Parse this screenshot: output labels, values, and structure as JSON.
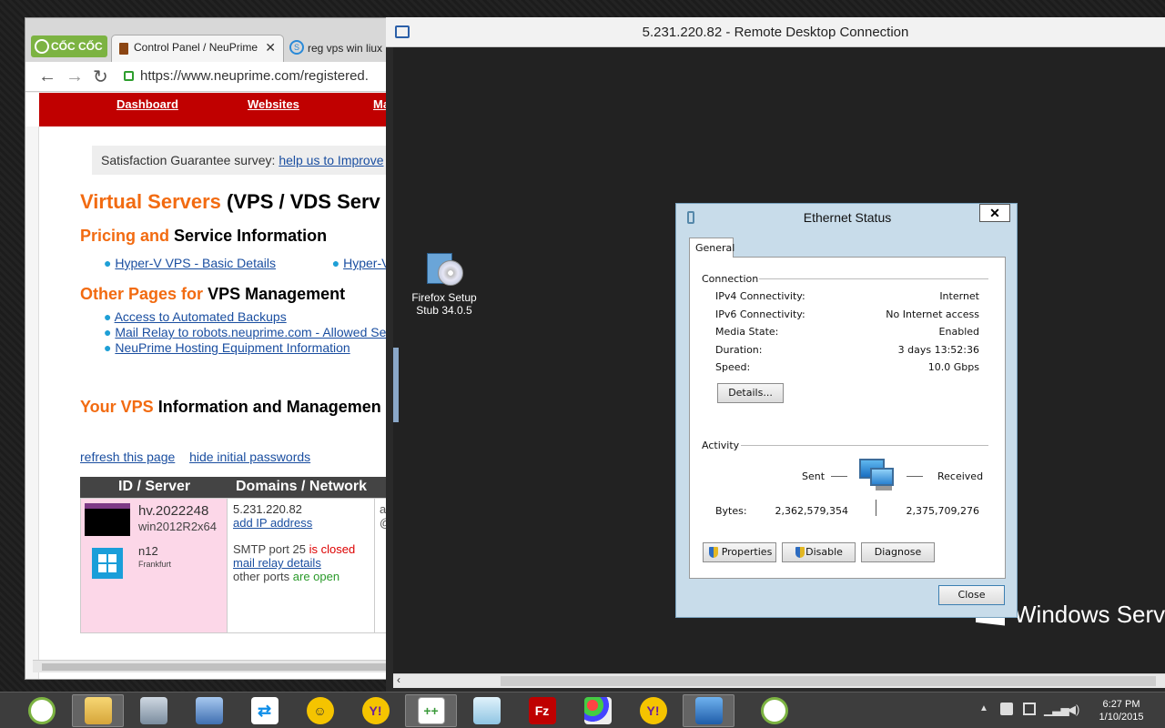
{
  "browser": {
    "logo_text": "CỐC CỐC",
    "tabs": [
      {
        "label": "Control Panel / NeuPrime"
      },
      {
        "label": "reg vps win liux"
      }
    ],
    "url": "https://www.neuprime.com/registered.",
    "nav": [
      "Dashboard",
      "Websites",
      "Ma"
    ],
    "survey_text": "Satisfaction Guarantee survey:",
    "survey_link": "help us to Improve",
    "h1_orange": "Virtual Servers",
    "h1_black": "(VPS / VDS Serv",
    "h2a_orange": "Pricing and",
    "h2a_black": "Service Information",
    "pricing_links": [
      "Hyper-V VPS - Basic Details",
      "Hyper-V"
    ],
    "h2b_orange": "Other Pages for",
    "h2b_black": "VPS Management",
    "other_links": [
      "Access to Automated Backups",
      "Mail Relay to robots.neuprime.com - Allowed Se",
      "NeuPrime Hosting Equipment Information"
    ],
    "h2c_orange": "Your VPS",
    "h2c_black": "Information and Managemen",
    "refresh_link": "refresh this page",
    "hide_link": "hide initial passwords",
    "table_headers": [
      "ID / Server",
      "Domains / Network"
    ],
    "server_id": "hv.2022248",
    "server_os": "win2012R2x64",
    "node": "n12",
    "location": "Frankfurt",
    "ip": "5.231.220.82",
    "add_ip": "add IP address",
    "smtp_text": "SMTP port 25",
    "smtp_status": "is closed",
    "relay_link": "mail relay details",
    "other_ports": "other ports",
    "open_status": "are open",
    "col3_a": "a",
    "col3_b": "@"
  },
  "rdp": {
    "title": "5.231.220.82 - Remote Desktop Connection",
    "desktop_icon_label1": "Firefox Setup",
    "desktop_icon_label2": "Stub 34.0.5",
    "windows_text": "Windows Serve"
  },
  "dialog": {
    "title": "Ethernet Status",
    "tab": "General",
    "connection_label": "Connection",
    "rows": [
      {
        "label": "IPv4 Connectivity:",
        "value": "Internet"
      },
      {
        "label": "IPv6 Connectivity:",
        "value": "No Internet access"
      },
      {
        "label": "Media State:",
        "value": "Enabled"
      },
      {
        "label": "Duration:",
        "value": "3 days 13:52:36"
      },
      {
        "label": "Speed:",
        "value": "10.0 Gbps"
      }
    ],
    "details_button": "Details...",
    "activity_label": "Activity",
    "sent_label": "Sent",
    "received_label": "Received",
    "bytes_label": "Bytes:",
    "bytes_sent": "2,362,579,354",
    "bytes_received": "2,375,709,276",
    "properties_button": "Properties",
    "disable_button": "Disable",
    "diagnose_button": "Diagnose",
    "close_button": "Close"
  },
  "taskbar": {
    "time": "6:27 PM",
    "date": "1/10/2015",
    "icons": [
      "coccoc-icon",
      "file-explorer-icon",
      "computer-icon",
      "network-icon",
      "teamviewer-icon",
      "messenger-icon",
      "yahoo-messenger-icon",
      "notepadpp-icon",
      "notepad-icon",
      "filezilla-icon",
      "paint-icon",
      "yahoo-messenger-icon",
      "remote-desktop-icon",
      "coccoc-icon"
    ]
  }
}
